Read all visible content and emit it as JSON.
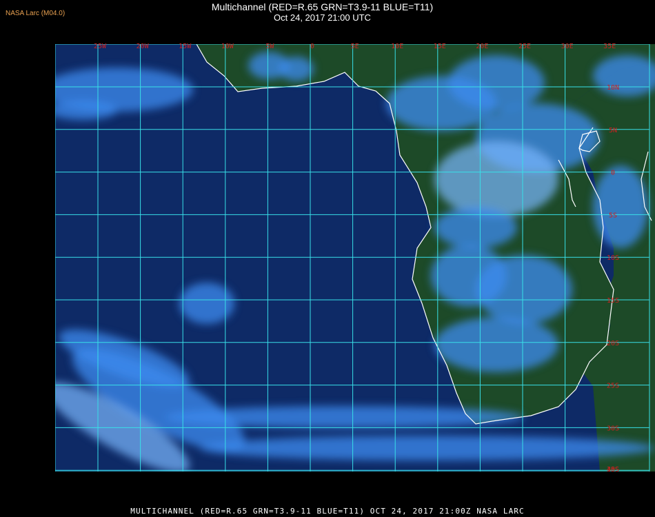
{
  "badge": "NASA Larc (M04.0)",
  "title": "Multichannel (RED=R.65 GRN=T3.9-11 BLUE=T11)",
  "subtitle": "Oct 24, 2017 21:00 UTC",
  "footer": "MULTICHANNEL (RED=R.65 GRN=T3.9-11 BLUE=T11) OCT 24, 2017 21:00Z   NASA LARC",
  "map": {
    "lon_labels": [
      "25W",
      "20W",
      "15W",
      "10W",
      "5W",
      "0",
      "5E",
      "10E",
      "15E",
      "20E",
      "25E",
      "30E",
      "35E"
    ],
    "lat_labels": [
      "10N",
      "5N",
      "0",
      "5S",
      "10S",
      "15S",
      "20S",
      "25S",
      "30S",
      "35S",
      "40S"
    ],
    "colors": {
      "ocean": "#0e2a66",
      "land": "#1d4a28",
      "cloud": "#3d8cf0",
      "cloud_bright": "#7ab8ff",
      "grid": "#38e0e8",
      "coast": "#ffffff",
      "label": "#d02020"
    }
  }
}
